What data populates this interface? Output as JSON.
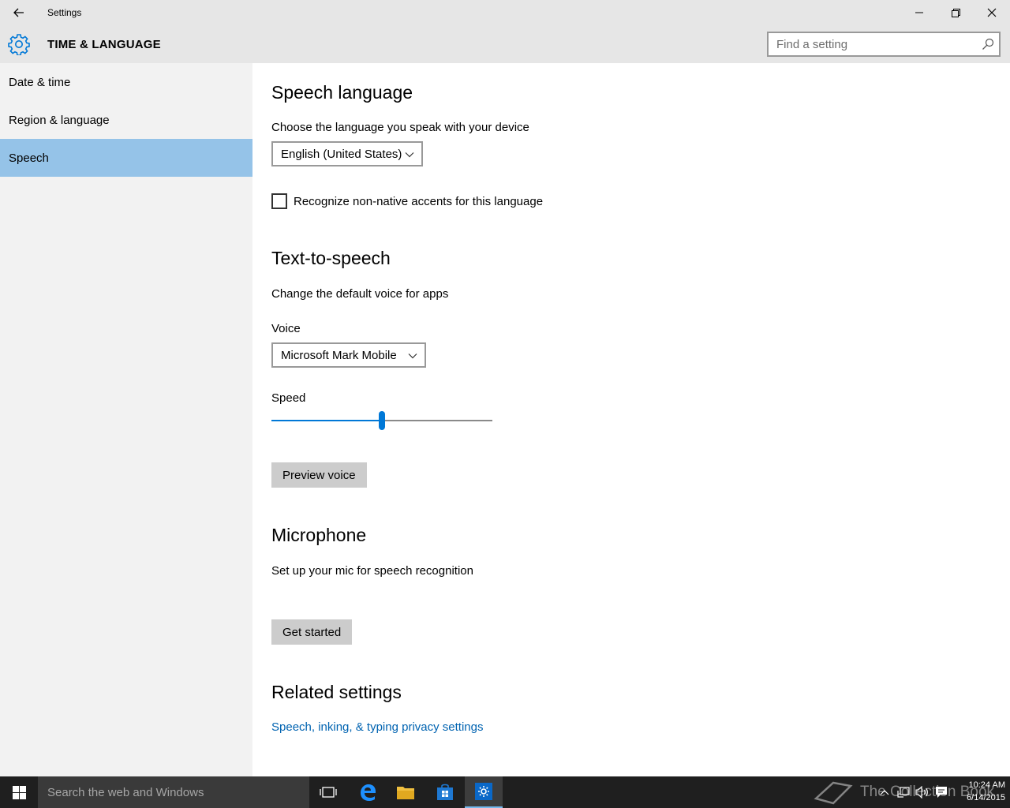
{
  "window": {
    "title": "Settings",
    "controls": {
      "minimize": "minimize-icon",
      "restore": "restore-icon",
      "close": "close-icon"
    }
  },
  "header": {
    "section_title": "TIME & LANGUAGE",
    "search_placeholder": "Find a setting"
  },
  "sidebar": {
    "items": [
      {
        "label": "Date & time",
        "selected": false
      },
      {
        "label": "Region & language",
        "selected": false
      },
      {
        "label": "Speech",
        "selected": true
      }
    ]
  },
  "speech_language": {
    "heading": "Speech language",
    "description": "Choose the language you speak with your device",
    "language_value": "English (United States)",
    "checkbox_label": "Recognize non-native accents for this language",
    "checkbox_checked": false
  },
  "text_to_speech": {
    "heading": "Text-to-speech",
    "description": "Change the default voice for apps",
    "voice_label": "Voice",
    "voice_value": "Microsoft Mark Mobile",
    "speed_label": "Speed",
    "speed_value": 0.5,
    "preview_button": "Preview voice"
  },
  "microphone": {
    "heading": "Microphone",
    "description": "Set up your mic for speech recognition",
    "get_started_button": "Get started"
  },
  "related": {
    "heading": "Related settings",
    "link": "Speech, inking, & typing privacy settings"
  },
  "taskbar": {
    "search_placeholder": "Search the web and Windows",
    "time": "10:24 AM",
    "date": "6/14/2015",
    "watermark": "The Collection Book"
  },
  "colors": {
    "accent": "#0078d7",
    "selected_nav": "#95c3e8",
    "link": "#0063b1"
  }
}
